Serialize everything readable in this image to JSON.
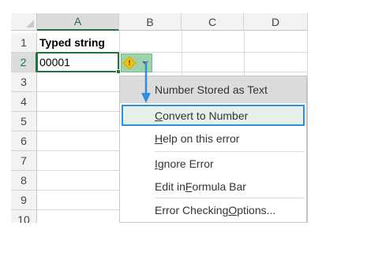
{
  "columns": [
    "A",
    "B",
    "C",
    "D"
  ],
  "rows": [
    "1",
    "2",
    "3",
    "4",
    "5",
    "6",
    "7",
    "8",
    "9",
    "10"
  ],
  "cells": {
    "a1": "Typed string",
    "a2": "00001"
  },
  "error_button": {
    "symbol": "!"
  },
  "menu": {
    "header": "Number Stored as Text",
    "items": [
      {
        "pre": "",
        "u": "C",
        "post": "onvert to Number"
      },
      {
        "pre": "",
        "u": "H",
        "post": "elp on this error"
      },
      {
        "pre": "",
        "u": "I",
        "post": "gnore Error"
      },
      {
        "pre": "Edit in ",
        "u": "F",
        "post": "ormula Bar"
      },
      {
        "pre": "Error Checking ",
        "u": "O",
        "post": "ptions..."
      }
    ]
  },
  "colors": {
    "excel_green": "#217346",
    "highlight_border": "#2f8ee0",
    "arrow": "#2f8ee0",
    "warning": "#f4c20d"
  }
}
